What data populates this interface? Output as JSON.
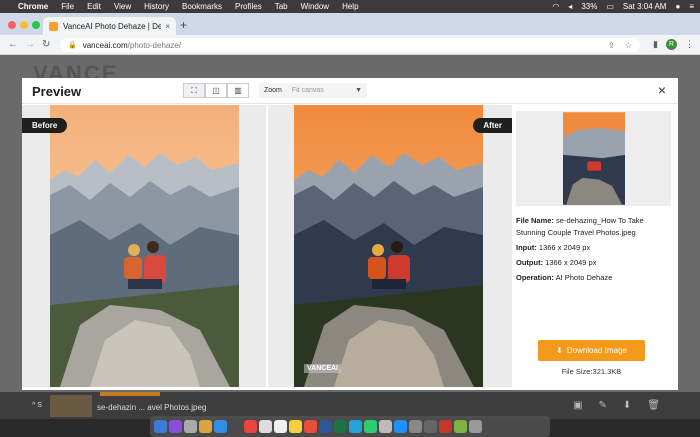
{
  "menubar": {
    "apple": "",
    "items": [
      "Chrome",
      "File",
      "Edit",
      "View",
      "History",
      "Bookmarks",
      "Profiles",
      "Tab",
      "Window",
      "Help"
    ],
    "battery": "33%",
    "clock": "Sat 3:04 AM"
  },
  "browser": {
    "tab_title": "VanceAI Photo Dehaze | Deha",
    "tab_close": "×",
    "new_tab": "+",
    "url_domain": "vanceai.com",
    "url_path": "/photo-dehaze/",
    "profile_initial": "R"
  },
  "page": {
    "logo": "VANCE"
  },
  "modal": {
    "title": "Preview",
    "zoom_label": "Zoom",
    "zoom_placeholder": "Fit canvas",
    "close": "×",
    "before_label": "Before",
    "after_label": "After",
    "watermark": "VANCEAI",
    "info": {
      "file_name_label": "File Name:",
      "file_name": "se-dehazing_How To Take Stunning Couple Travel Photos.jpeg",
      "input_label": "Input:",
      "input": "1366 x 2049 px",
      "output_label": "Output:",
      "output": "1366 x 2049 px",
      "operation_label": "Operation:",
      "operation": "AI Photo Dehaze"
    },
    "download_label": "Download Image",
    "file_size": "File Size:321.3KB"
  },
  "shelf": {
    "filename": "se-dehazin ... avel Photos.jpeg",
    "left_text": "^  S"
  },
  "colors": {
    "accent": "#f39a1c",
    "tag_bg": "#1f1f1f"
  }
}
